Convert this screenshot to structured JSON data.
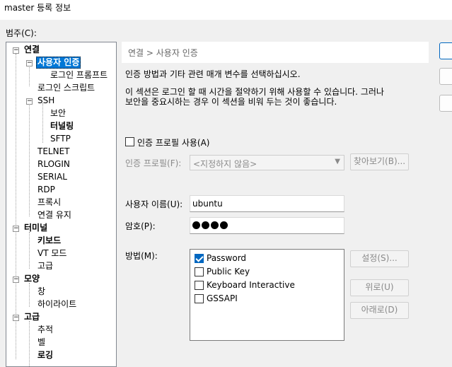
{
  "window": {
    "title": "master 등록 정보"
  },
  "category_label": "범주(C):",
  "tree": [
    {
      "label": "연결",
      "bold": true,
      "expander": "−"
    },
    {
      "label": "사용자 인증",
      "selected": true,
      "expander": "−"
    },
    {
      "label": "로그인 프롬프트"
    },
    {
      "label": "로그인 스크립트"
    },
    {
      "label": "SSH",
      "expander": "−"
    },
    {
      "label": "보안"
    },
    {
      "label": "터널링",
      "bold": true
    },
    {
      "label": "SFTP"
    },
    {
      "label": "TELNET"
    },
    {
      "label": "RLOGIN"
    },
    {
      "label": "SERIAL"
    },
    {
      "label": "RDP"
    },
    {
      "label": "프록시"
    },
    {
      "label": "연결 유지"
    },
    {
      "label": "터미널",
      "bold": true,
      "expander": "−"
    },
    {
      "label": "키보드",
      "bold": true
    },
    {
      "label": "VT 모드"
    },
    {
      "label": "고급"
    },
    {
      "label": "모양",
      "bold": true,
      "expander": "−"
    },
    {
      "label": "창"
    },
    {
      "label": "하이라이트"
    },
    {
      "label": "고급",
      "bold": true,
      "expander": "−"
    },
    {
      "label": "추적"
    },
    {
      "label": "벨"
    },
    {
      "label": "로깅",
      "bold": true
    }
  ],
  "panel": {
    "breadcrumb": "연결 > 사용자 인증",
    "description1": "인증 방법과 기타 관련 매개 변수를 선택하십시오.",
    "description2_line1": "이 섹션은 로그인 할 때 시간을 절약하기 위해 사용할 수 있습니다. 그러나",
    "description2_line2": "보안을 중요시하는 경우 이 섹션을 비워 두는 것이 좋습니다.",
    "use_profile_label": "인증 프로필 사용(A)",
    "use_profile_checked": false,
    "profile_label": "인증 프로필(F):",
    "profile_value": "<지정하지 않음>",
    "browse_button": "찾아보기(B)...",
    "username_label": "사용자 이름(U):",
    "username_value": "ubuntu",
    "password_label": "암호(P):",
    "password_dot_count": 4,
    "method_label": "방법(M):",
    "methods": [
      {
        "label": "Password",
        "checked": true
      },
      {
        "label": "Public Key",
        "checked": false
      },
      {
        "label": "Keyboard Interactive",
        "checked": false
      },
      {
        "label": "GSSAPI",
        "checked": false
      }
    ],
    "settings_button": "설정(S)...",
    "up_button": "위로(U)",
    "down_button": "아래로(D)"
  },
  "colors": {
    "accent": "#0078d7",
    "check": "#0067c0"
  }
}
